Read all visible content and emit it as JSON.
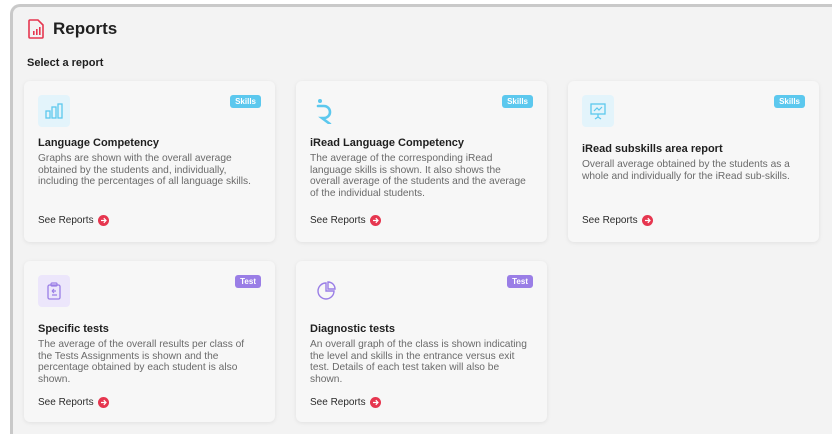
{
  "page": {
    "title": "Reports",
    "subtitle": "Select a report"
  },
  "cards": [
    {
      "icon": "bar-chart-icon",
      "badge": "Skills",
      "title": "Language Competency",
      "description": "Graphs are shown with the overall average obtained by the students and, individually, including the percentages of all language skills.",
      "link": "See Reports"
    },
    {
      "icon": "iread-logo-icon",
      "badge": "Skills",
      "title": "iRead Language Competency",
      "description": "The average of the corresponding iRead language skills is shown. It also shows the overall average of the students and the average of the individual students.",
      "link": "See Reports"
    },
    {
      "icon": "presentation-chart-icon",
      "badge": "Skills",
      "title": "iRead subskills area report",
      "description": "Overall average obtained by the students as a whole and individually for the iRead sub-skills.",
      "link": "See Reports"
    },
    {
      "icon": "clipboard-icon",
      "badge": "Test",
      "title": "Specific tests",
      "description": "The average of the overall results per class of the Tests Assignments is shown and the percentage obtained by each student is also shown.",
      "link": "See Reports"
    },
    {
      "icon": "pie-chart-icon",
      "badge": "Test",
      "title": "Diagnostic tests",
      "description": "An overall graph of the class is shown indicating the level and skills in the entrance versus exit test. Details of each test taken will also be shown.",
      "link": "See Reports"
    }
  ],
  "colors": {
    "skills_badge": "#5cc8ee",
    "test_badge": "#9a7ee6",
    "skills_icon_bg": "#e3f4fb",
    "test_icon_bg": "#ece6fb",
    "arrow": "#e6364f",
    "title_icon": "#e6364f"
  }
}
